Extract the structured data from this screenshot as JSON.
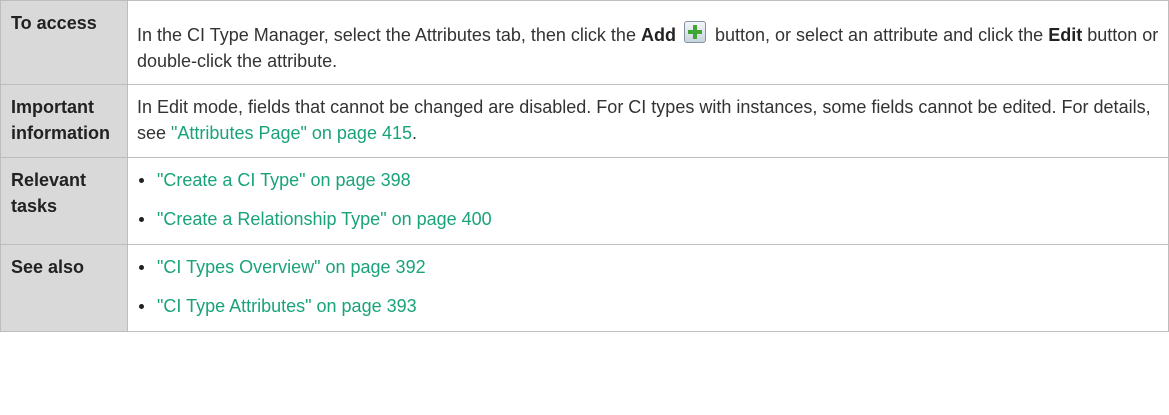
{
  "rows": {
    "access": {
      "label": "To access",
      "text_1": "In the CI Type Manager, select the Attributes tab, then click the ",
      "add_label": "Add",
      "add_icon": "add-plus-icon",
      "text_2": " button, or select an attribute and click the ",
      "edit_label": "Edit",
      "text_3": " button or double-click the attribute."
    },
    "important": {
      "label": "Important information",
      "text_1": "In Edit mode, fields that cannot be changed are disabled. For CI types with instances, some fields cannot be edited. For details, see ",
      "link": "\"Attributes Page\" on page 415",
      "text_2": "."
    },
    "tasks": {
      "label": "Relevant tasks",
      "items": [
        "\"Create a CI Type\" on page 398",
        "\"Create a Relationship Type\" on page 400"
      ]
    },
    "see_also": {
      "label": "See also",
      "items": [
        "\"CI Types Overview\" on page 392",
        "\"CI Type Attributes\" on page 393"
      ]
    }
  },
  "colors": {
    "link": "#1aa37b",
    "label_bg": "#d9d9d9",
    "border": "#bdbdbd"
  }
}
